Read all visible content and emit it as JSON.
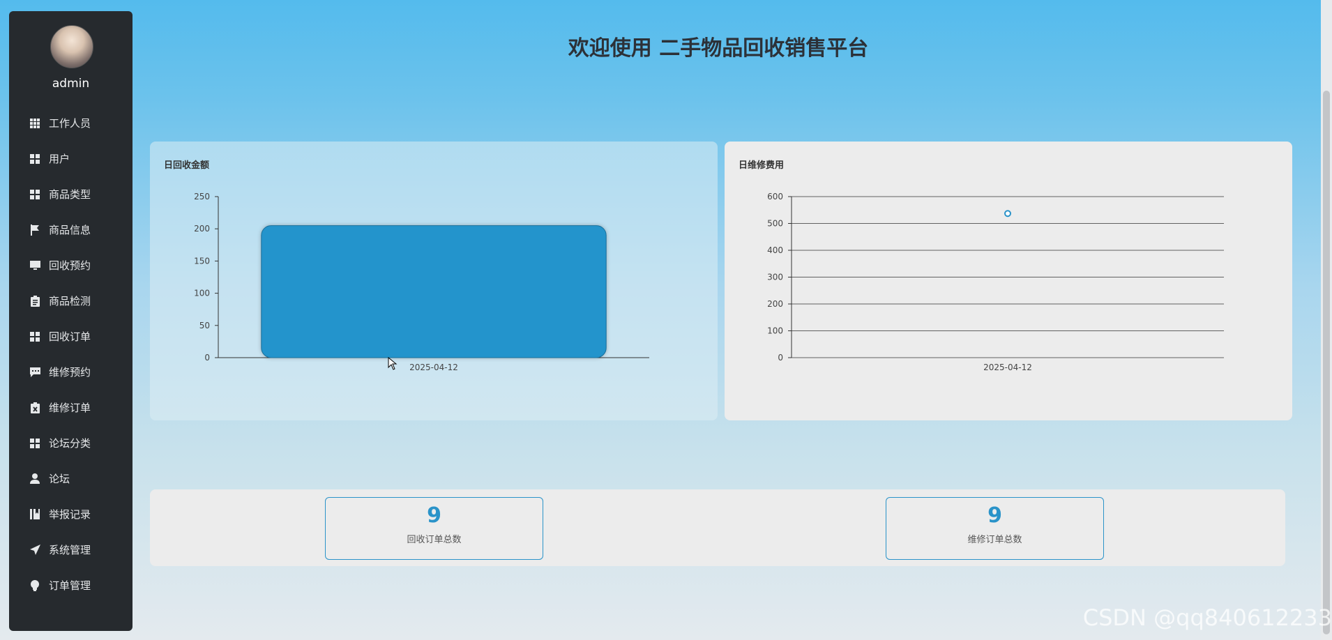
{
  "user": {
    "name": "admin"
  },
  "sidebar": {
    "items": [
      {
        "label": "工作人员",
        "icon": "grid-icon"
      },
      {
        "label": "用户",
        "icon": "apps-icon"
      },
      {
        "label": "商品类型",
        "icon": "apps-icon"
      },
      {
        "label": "商品信息",
        "icon": "flag-icon"
      },
      {
        "label": "回收预约",
        "icon": "monitor-icon"
      },
      {
        "label": "商品检测",
        "icon": "clipboard-icon"
      },
      {
        "label": "回收订单",
        "icon": "apps-icon"
      },
      {
        "label": "维修预约",
        "icon": "comment-icon"
      },
      {
        "label": "维修订单",
        "icon": "clipboard-x-icon"
      },
      {
        "label": "论坛分类",
        "icon": "apps-icon"
      },
      {
        "label": "论坛",
        "icon": "user-icon"
      },
      {
        "label": "举报记录",
        "icon": "book-icon"
      },
      {
        "label": "系统管理",
        "icon": "send-icon"
      },
      {
        "label": "订单管理",
        "icon": "bulb-icon"
      }
    ]
  },
  "header": {
    "title": "欢迎使用 二手物品回收销售平台"
  },
  "colors": {
    "accent": "#2a93c9",
    "bar": "#2394cc",
    "sidebar_bg": "#262a2e"
  },
  "chart_data": [
    {
      "type": "bar",
      "title": "日回收金额",
      "categories": [
        "2025-04-12"
      ],
      "values": [
        205
      ],
      "ylim": [
        0,
        250
      ],
      "yticks": [
        0,
        50,
        100,
        150,
        200,
        250
      ],
      "grid": false
    },
    {
      "type": "scatter",
      "title": "日维修费用",
      "x": [
        "2025-04-12"
      ],
      "y": [
        537
      ],
      "ylim": [
        0,
        600
      ],
      "yticks": [
        0,
        100,
        200,
        300,
        400,
        500,
        600
      ],
      "grid": true
    }
  ],
  "stats": [
    {
      "value": "9",
      "label": "回收订单总数"
    },
    {
      "value": "9",
      "label": "维修订单总数"
    }
  ],
  "watermark": "CSDN @qq840612233"
}
